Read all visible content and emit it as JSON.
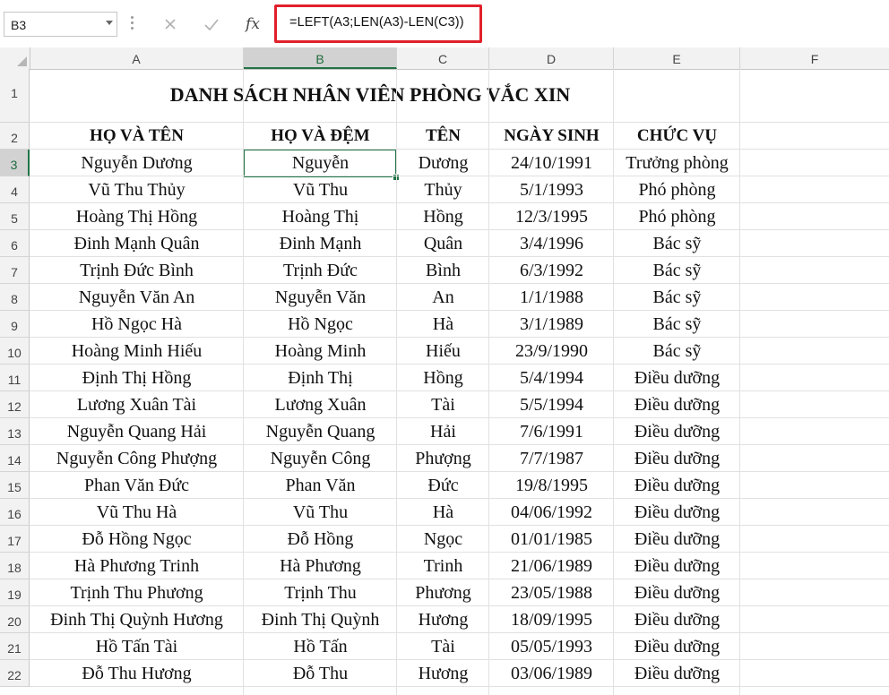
{
  "formula_bar": {
    "name_box": "B3",
    "cancel_icon": "close-icon",
    "enter_icon": "check-icon",
    "fx_label": "fx",
    "formula": "=LEFT(A3;LEN(A3)-LEN(C3))",
    "highlight_color": "#e0202b"
  },
  "columns": [
    "A",
    "B",
    "C",
    "D",
    "E",
    "F"
  ],
  "selected_column": "B",
  "selected_row": "3",
  "rows": [
    "1",
    "2",
    "3",
    "4",
    "5",
    "6",
    "7",
    "8",
    "9",
    "10",
    "11",
    "12",
    "13",
    "14",
    "15",
    "16",
    "17",
    "18",
    "19",
    "20",
    "21",
    "22"
  ],
  "sheet": {
    "title": "DANH SÁCH NHÂN VIÊN PHÒNG VẮC XIN",
    "headers": [
      "HỌ VÀ TÊN",
      "HỌ VÀ ĐỆM",
      "TÊN",
      "NGÀY SINH",
      "CHỨC VỤ"
    ],
    "records": [
      [
        "Nguyễn Dương",
        "Nguyễn",
        "Dương",
        "24/10/1991",
        "Trưởng phòng"
      ],
      [
        "Vũ Thu Thủy",
        "Vũ Thu",
        "Thủy",
        "5/1/1993",
        "Phó phòng"
      ],
      [
        "Hoàng Thị Hồng",
        "Hoàng Thị",
        "Hồng",
        "12/3/1995",
        "Phó phòng"
      ],
      [
        "Đinh Mạnh Quân",
        "Đinh Mạnh",
        "Quân",
        "3/4/1996",
        "Bác sỹ"
      ],
      [
        "Trịnh Đức Bình",
        "Trịnh Đức",
        "Bình",
        "6/3/1992",
        "Bác sỹ"
      ],
      [
        "Nguyễn Văn An",
        "Nguyễn Văn",
        "An",
        "1/1/1988",
        "Bác sỹ"
      ],
      [
        "Hồ Ngọc Hà",
        "Hồ Ngọc",
        "Hà",
        "3/1/1989",
        "Bác sỹ"
      ],
      [
        "Hoàng Minh Hiếu",
        "Hoàng Minh",
        "Hiếu",
        "23/9/1990",
        "Bác sỹ"
      ],
      [
        "Định Thị Hồng",
        "Định Thị",
        "Hồng",
        "5/4/1994",
        "Điều dưỡng"
      ],
      [
        "Lương Xuân Tài",
        "Lương Xuân",
        "Tài",
        "5/5/1994",
        "Điều dưỡng"
      ],
      [
        "Nguyễn Quang Hải",
        "Nguyễn Quang",
        "Hải",
        "7/6/1991",
        "Điều dưỡng"
      ],
      [
        "Nguyễn Công Phượng",
        "Nguyễn Công",
        "Phượng",
        "7/7/1987",
        "Điều dưỡng"
      ],
      [
        "Phan Văn Đức",
        "Phan Văn",
        "Đức",
        "19/8/1995",
        "Điều dưỡng"
      ],
      [
        "Vũ Thu Hà",
        "Vũ Thu",
        "Hà",
        "04/06/1992",
        "Điều dưỡng"
      ],
      [
        "Đỗ Hồng Ngọc",
        "Đỗ Hồng",
        "Ngọc",
        "01/01/1985",
        "Điều dưỡng"
      ],
      [
        "Hà Phương Trinh",
        "Hà Phương",
        "Trinh",
        "21/06/1989",
        "Điều dưỡng"
      ],
      [
        "Trịnh Thu Phương",
        "Trịnh Thu",
        "Phương",
        "23/05/1988",
        "Điều dưỡng"
      ],
      [
        "Đinh Thị Quỳnh Hương",
        "Đinh Thị Quỳnh",
        "Hương",
        "18/09/1995",
        "Điều dưỡng"
      ],
      [
        "Hồ Tấn Tài",
        "Hồ Tấn",
        "Tài",
        "05/05/1993",
        "Điều dưỡng"
      ],
      [
        "Đỗ Thu Hương",
        "Đỗ Thu",
        "Hương",
        "03/06/1989",
        "Điều dưỡng"
      ]
    ]
  },
  "colors": {
    "selection_green": "#217346",
    "header_bg": "#f2f2f2"
  }
}
